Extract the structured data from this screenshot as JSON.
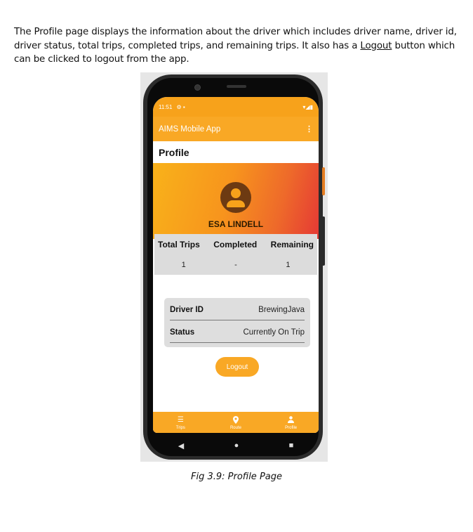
{
  "document": {
    "intro_part1": "The Profile page displays the information about the driver which includes driver name, driver id, driver status, total trips, completed trips, and remaining trips. It also has a ",
    "intro_link": "Logout",
    "intro_part2": " button which can be clicked to logout from the app.",
    "caption": "Fig 3.9: Profile Page"
  },
  "phone": {
    "status_time": "11:51",
    "status_icons_left": "⚙ ▪",
    "status_icons_right": "▾◢▮",
    "app_title": "AIMS Mobile App",
    "menu_icon": "⋮",
    "page_title": "Profile",
    "driver_name": "ESA LINDELL",
    "stats": {
      "headers": [
        "Total Trips",
        "Completed",
        "Remaining"
      ],
      "values": [
        "1",
        "-",
        "1"
      ]
    },
    "details": [
      {
        "label": "Driver ID",
        "value": "BrewingJava"
      },
      {
        "label": "Status",
        "value": "Currently On Trip"
      }
    ],
    "logout_label": "Logout",
    "bottom_nav": [
      {
        "label": "Trips",
        "icon": "list-icon"
      },
      {
        "label": "Route",
        "icon": "location-pin-icon"
      },
      {
        "label": "Profile",
        "icon": "person-icon"
      }
    ]
  },
  "colors": {
    "accent": "#f9a825",
    "gradient_end": "#e53935",
    "avatar": "#6d3a12"
  }
}
